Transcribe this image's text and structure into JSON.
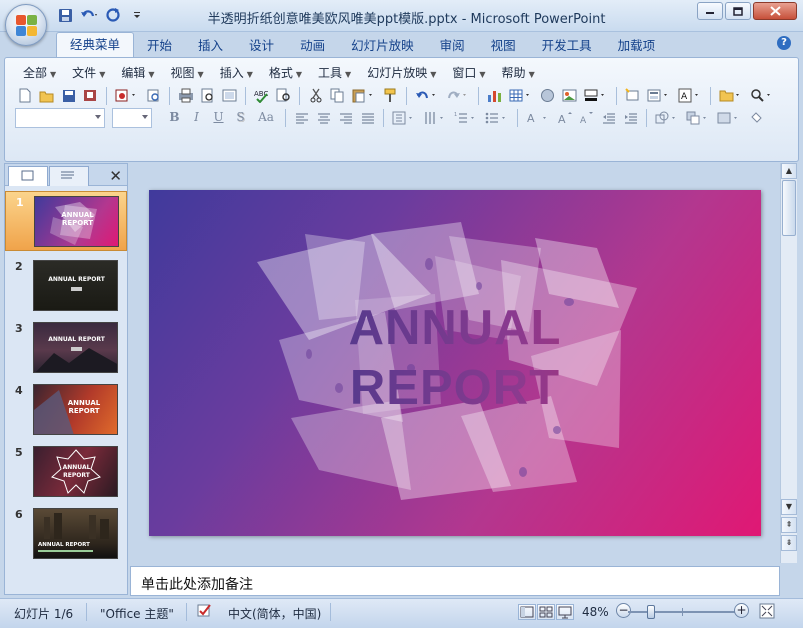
{
  "window": {
    "title": "半透明折纸创意唯美欧风唯美ppt模版.pptx - Microsoft PowerPoint",
    "controls": [
      "minimize",
      "maximize",
      "close"
    ]
  },
  "quick_access": [
    "save-icon",
    "undo-icon",
    "redo-icon",
    "customize-icon"
  ],
  "ribbon_tabs": [
    "经典菜单",
    "开始",
    "插入",
    "设计",
    "动画",
    "幻灯片放映",
    "审阅",
    "视图",
    "开发工具",
    "加载项"
  ],
  "ribbon_active_tab": "经典菜单",
  "menu": [
    "全部",
    "文件",
    "编辑",
    "视图",
    "插入",
    "格式",
    "工具",
    "幻灯片放映",
    "窗口",
    "帮助"
  ],
  "format_buttons": [
    "B",
    "I",
    "U",
    "S",
    "Aa"
  ],
  "slides": [
    {
      "num": "1",
      "text": "ANNUAL\nREPORT"
    },
    {
      "num": "2",
      "text": "ANNUAL REPORT"
    },
    {
      "num": "3",
      "text": "ANNUAL REPORT"
    },
    {
      "num": "4",
      "text": "ANNUAL\nREPORT"
    },
    {
      "num": "5",
      "text": "ANNUAL\nREPORT"
    },
    {
      "num": "6",
      "text": "ANNUAL REPORT"
    }
  ],
  "selected_slide": 1,
  "slide": {
    "title_line1": "ANNUAL",
    "title_line2": "REPORT",
    "colors": {
      "start": "#403a9c",
      "end": "#e01874"
    }
  },
  "notes": {
    "placeholder": "单击此处添加备注"
  },
  "status": {
    "slide_info": "幻灯片 1/6",
    "theme": "\"Office 主题\"",
    "language": "中文(简体，中国)",
    "zoom": "48%",
    "zoom_value": 48
  }
}
